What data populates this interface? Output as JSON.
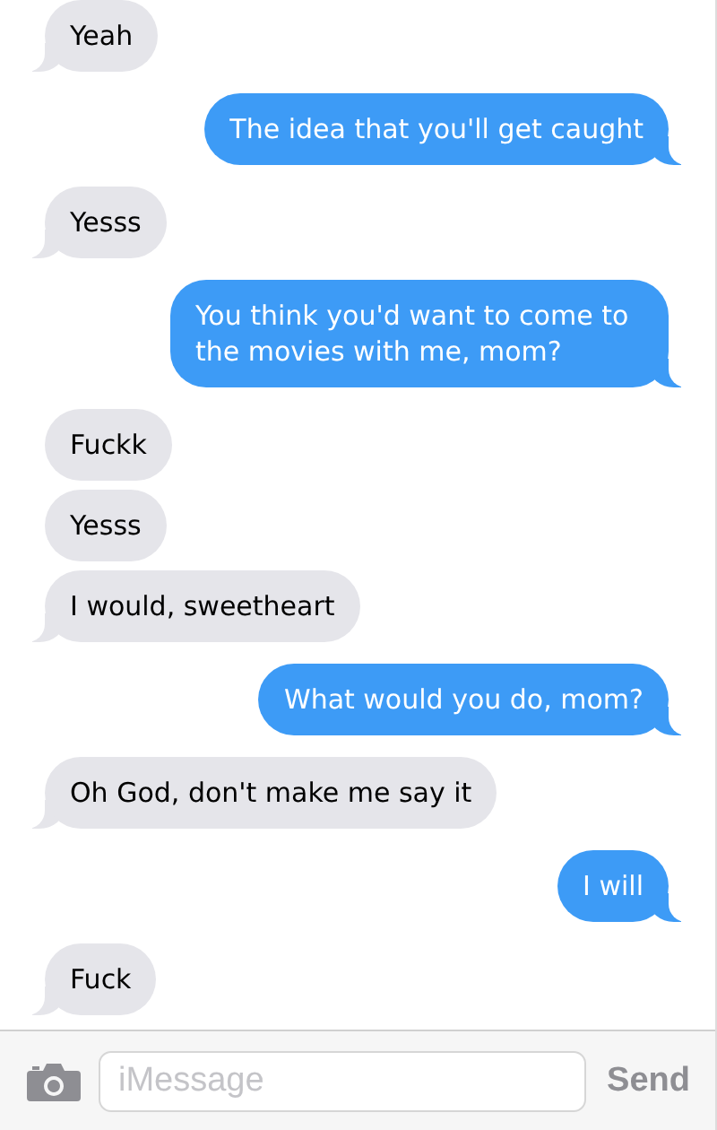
{
  "messages": [
    {
      "text": "Yeah",
      "kind": "received",
      "tail": true
    },
    {
      "text": "The idea that you'll get caught",
      "kind": "sent",
      "tail": true
    },
    {
      "text": "Yesss",
      "kind": "received",
      "tail": true
    },
    {
      "text": "You think you'd want to come to the movies with me, mom?",
      "kind": "sent",
      "tail": true
    },
    {
      "text": "Fuckk",
      "kind": "received",
      "tail": false
    },
    {
      "text": "Yesss",
      "kind": "received",
      "tail": false
    },
    {
      "text": "I would, sweetheart",
      "kind": "received",
      "tail": true
    },
    {
      "text": "What would you do, mom?",
      "kind": "sent",
      "tail": true
    },
    {
      "text": "Oh God, don't make me say it",
      "kind": "received",
      "tail": true
    },
    {
      "text": "I will",
      "kind": "sent",
      "tail": true
    },
    {
      "text": "Fuck",
      "kind": "received",
      "tail": true
    }
  ],
  "composer": {
    "placeholder": "iMessage",
    "send": {
      "label": "Send",
      "disabled": true
    }
  }
}
